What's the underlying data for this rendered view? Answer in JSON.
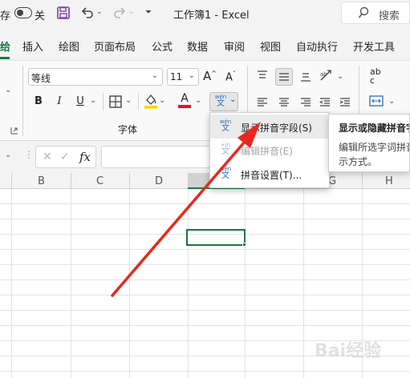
{
  "titlebar": {
    "autosave_label": "存",
    "toggle_state": "关",
    "window_title": "工作簿1 - Excel",
    "search_placeholder": "搜索"
  },
  "tabs": [
    {
      "label": "给"
    },
    {
      "label": "插入"
    },
    {
      "label": "绘图"
    },
    {
      "label": "页面布局"
    },
    {
      "label": "公式"
    },
    {
      "label": "数据"
    },
    {
      "label": "审阅"
    },
    {
      "label": "视图"
    },
    {
      "label": "自动执行"
    },
    {
      "label": "开发工具"
    }
  ],
  "ribbon": {
    "font_name": "等线",
    "font_size": "11",
    "bold": "B",
    "italic": "I",
    "underline": "U",
    "grow_font": "A",
    "shrink_font": "A",
    "font_color": "A",
    "font_group_label": "字体",
    "wrap_label": "ab",
    "wrap_label2": "c",
    "font_color_hex": "#e81123",
    "fill_color_hex": "#ffd400"
  },
  "formulabar": {
    "fx_label": "fx"
  },
  "columns": [
    "B",
    "C",
    "D",
    "E",
    "F",
    "G",
    "H"
  ],
  "menu": {
    "items": [
      {
        "label": "显示拼音字段(S)",
        "icon_top": "wén",
        "icon_bottom": "文",
        "enabled": true
      },
      {
        "label": "编辑拼音(E)",
        "icon_top": "+ín",
        "icon_bottom": "文",
        "enabled": false
      },
      {
        "label": "拼音设置(T)...",
        "icon_top": "wén",
        "icon_bottom": "文",
        "enabled": true
      }
    ]
  },
  "tooltip": {
    "title": "显示或隐藏拼音字",
    "body_line1": "编辑所选字词拼音",
    "body_line2": "示方式。"
  },
  "watermark": "Bai经验",
  "accent_color": "#107c41",
  "arrow_color": "#e8281c"
}
